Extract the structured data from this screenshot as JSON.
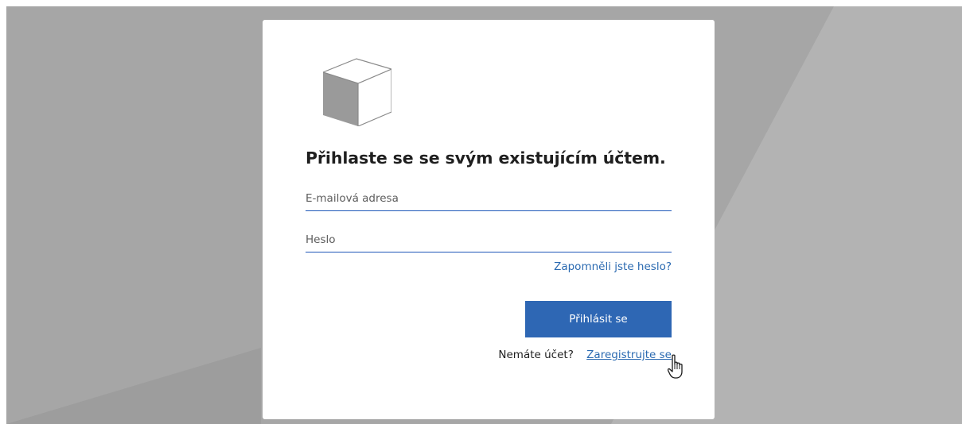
{
  "login": {
    "title": "Přihlaste se se svým existujícím účtem.",
    "email_placeholder": "E-mailová adresa",
    "password_placeholder": "Heslo",
    "forgot_password": "Zapomněli jste heslo?",
    "signin_button": "Přihlásit se",
    "no_account_text": "Nemáte účet?",
    "register_link": "Zaregistrujte se"
  },
  "icons": {
    "logo": "cube-logo-icon",
    "cursor": "hand-pointer-icon"
  },
  "colors": {
    "background": "#a6a6a6",
    "card": "#ffffff",
    "accent": "#2e67b4",
    "link": "#2b6ab1",
    "input_underline": "#1e57b8"
  }
}
